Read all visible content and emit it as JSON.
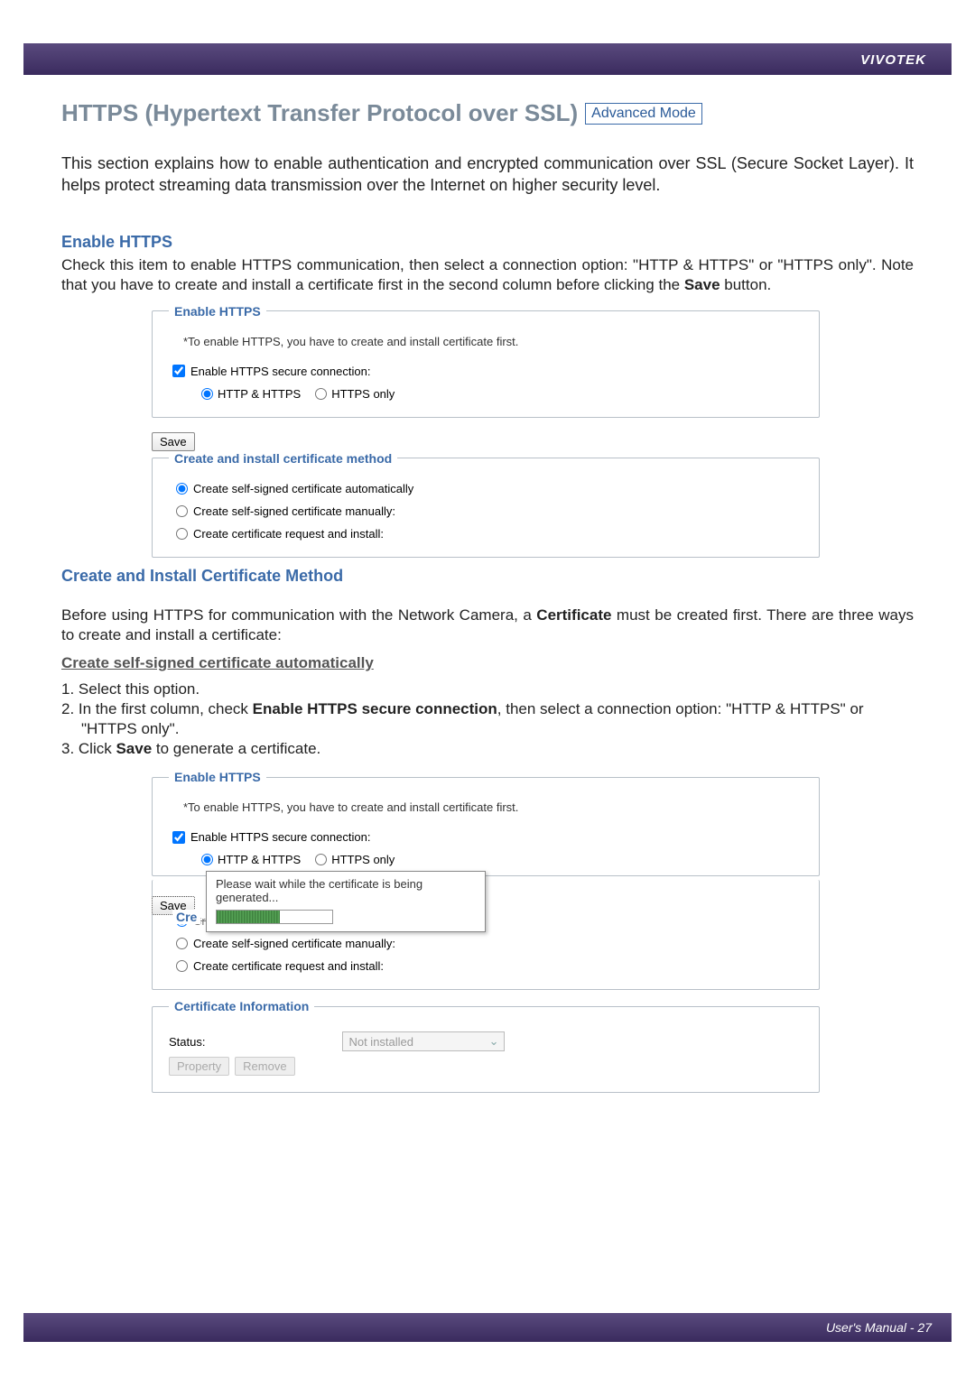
{
  "header": {
    "brand": "VIVOTEK"
  },
  "title": {
    "main": "HTTPS (Hypertext Transfer Protocol over SSL)",
    "badge": "Advanced Mode"
  },
  "intro": "This section explains how to enable authentication and encrypted communication over SSL (Secure Socket Layer). It helps protect streaming data transmission over the Internet on higher security level.",
  "enable_https": {
    "heading": "Enable HTTPS",
    "desc_pre": "Check this item to enable HTTPS communication, then select a connection option: \"HTTP & HTTPS\" or \"HTTPS only\". Note that you have to create and install a certificate first in the second column before clicking the ",
    "save_word": "Save",
    "desc_post": " button."
  },
  "shot1": {
    "fieldset1_legend": "Enable HTTPS",
    "warning": "*To enable HTTPS, you have to create and install certificate first.",
    "checkbox_label": "Enable HTTPS secure connection:",
    "radio_http_https": "HTTP & HTTPS",
    "radio_https_only": "HTTPS only",
    "save": "Save",
    "fieldset2_legend": "Create and install certificate method",
    "opt1": "Create self-signed certificate automatically",
    "opt2": "Create self-signed certificate manually:",
    "opt3": "Create certificate request and install:"
  },
  "create_install": {
    "heading": "Create and Install Certificate Method",
    "intro_pre": "Before using HTTPS for communication with the Network Camera, a ",
    "cert_word": "Certificate",
    "intro_post": " must be created first. There are three ways to create and install a certificate:",
    "sub_heading": "Create self-signed certificate automatically",
    "step1": "1. Select this option.",
    "step2_pre": "2. In the first column, check ",
    "step2_bold": "Enable HTTPS secure connection",
    "step2_post": ", then select a connection option: \"HTTP & HTTPS\" or \"HTTPS only\".",
    "step3_pre": "3. Click ",
    "step3_bold": "Save",
    "step3_post": " to generate a certificate."
  },
  "shot2": {
    "fieldset1_legend": "Enable HTTPS",
    "warning": "*To enable HTTPS, you have to create and install certificate first.",
    "checkbox_label": "Enable HTTPS secure connection:",
    "radio_http_https": "HTTP & HTTPS",
    "radio_https_only": "HTTPS only",
    "save": "Save",
    "half_legend": "Cre",
    "progress_text": "Please wait while the certificate is being generated...",
    "opt1": "Create self-signed certificate automatically",
    "opt2": "Create self-signed certificate manually:",
    "opt3": "Create certificate request and install:",
    "cert_info_legend": "Certificate Information",
    "status_label": "Status:",
    "status_value": "Not installed",
    "btn_property": "Property",
    "btn_remove": "Remove"
  },
  "footer": {
    "text": "User's Manual - 27"
  }
}
